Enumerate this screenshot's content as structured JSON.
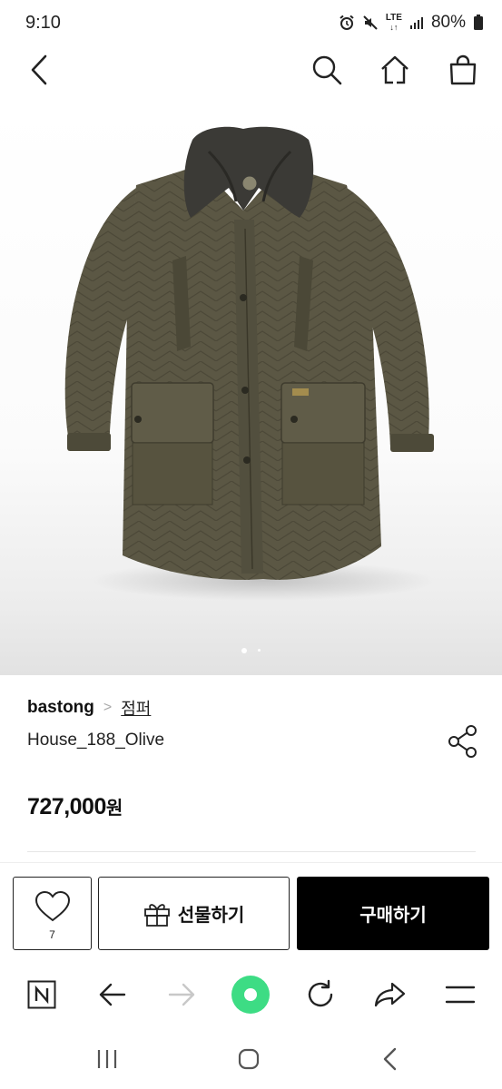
{
  "status": {
    "time": "9:10",
    "network": "LTE",
    "battery": "80%"
  },
  "product": {
    "brand": "bastong",
    "category": "점퍼",
    "name": "House_188_Olive",
    "price": "727,000",
    "price_unit": "원",
    "image_count": 2,
    "current_image": 1
  },
  "actions": {
    "like_count": "7",
    "gift_label": "선물하기",
    "buy_label": "구매하기"
  },
  "icons": {
    "back": "back-icon",
    "search": "search-icon",
    "home": "home-icon",
    "bag": "shopping-bag-icon",
    "share": "share-icon",
    "heart": "heart-icon",
    "gift": "gift-icon"
  },
  "colors": {
    "buy_button": "#000000",
    "reload_indicator": "#3ddc84",
    "coat": "#5b5744"
  }
}
